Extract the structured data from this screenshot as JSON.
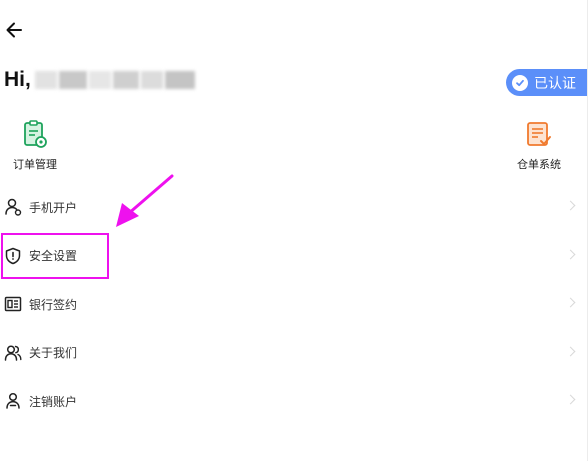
{
  "header": {
    "greeting": "Hi,",
    "verified_label": "已认证"
  },
  "quick_actions": [
    {
      "label": "订单管理",
      "icon": "order-management-icon",
      "color": "#1ea35c"
    },
    {
      "label": "仓单系统",
      "icon": "warehouse-receipt-icon",
      "color": "#f07a2e"
    }
  ],
  "menu": [
    {
      "label": "手机开户",
      "icon": "person-icon"
    },
    {
      "label": "安全设置",
      "icon": "shield-icon"
    },
    {
      "label": "银行签约",
      "icon": "bank-card-icon"
    },
    {
      "label": "关于我们",
      "icon": "people-icon"
    },
    {
      "label": "注销账户",
      "icon": "user-cancel-icon"
    }
  ],
  "colors": {
    "badge": "#5b8ff9",
    "annotation": "#ee11ee",
    "green": "#1ea35c",
    "orange": "#f07a2e"
  }
}
